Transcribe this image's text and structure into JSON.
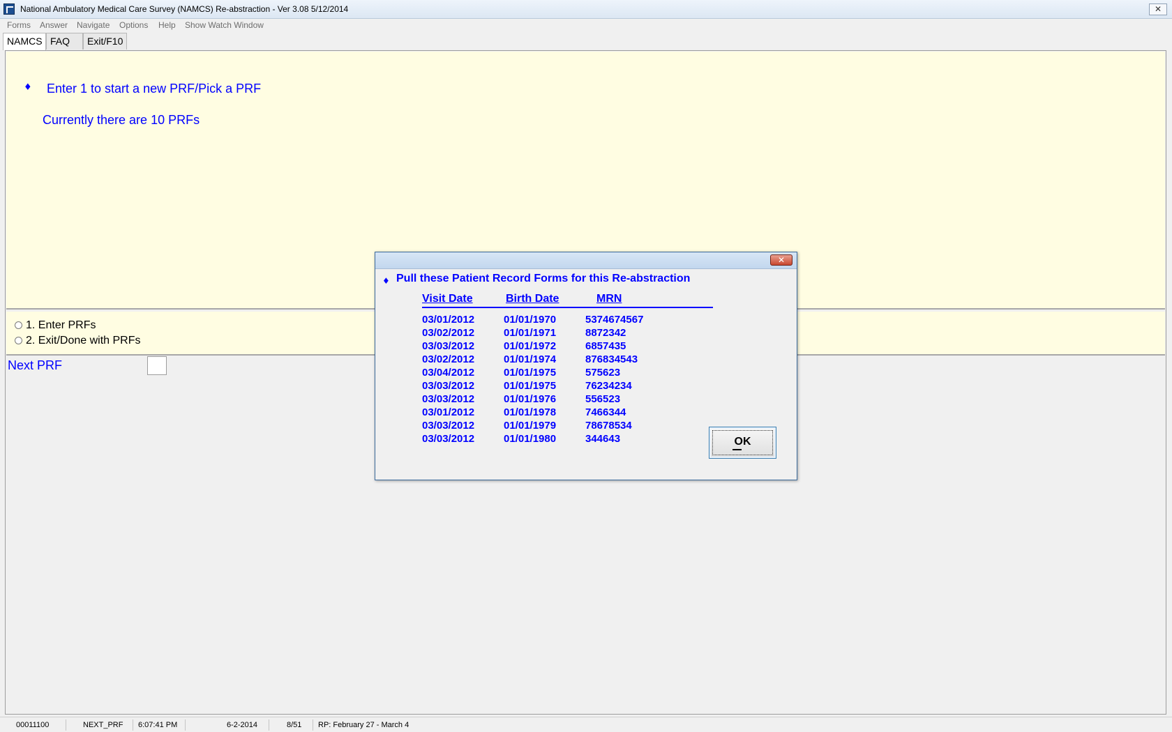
{
  "window": {
    "title": "National Ambulatory Medical Care Survey (NAMCS) Re-abstraction  - Ver 3.08 5/12/2014",
    "close_glyph": "✕"
  },
  "menu": {
    "items": [
      "Forms",
      "Answer",
      "Navigate",
      "Options",
      "Help",
      "Show Watch Window"
    ]
  },
  "tabs": [
    "NAMCS",
    "FAQ",
    "Exit/F10"
  ],
  "question": {
    "bullet": "♦",
    "prompt": "Enter 1 to start a new PRF/Pick a PRF",
    "info": "Currently there are 10 PRFs"
  },
  "answers": [
    {
      "number": "1.",
      "label": "Enter PRFs"
    },
    {
      "number": "2.",
      "label": "Exit/Done with PRFs"
    }
  ],
  "next_prf": {
    "label": "Next PRF",
    "value": ""
  },
  "dialog": {
    "bullet": "♦",
    "title": "Pull these Patient Record Forms for this Re-abstraction",
    "columns": [
      "Visit Date",
      "Birth Date",
      "MRN"
    ],
    "rows": [
      [
        "03/01/2012",
        "01/01/1970",
        "5374674567"
      ],
      [
        "03/02/2012",
        "01/01/1971",
        "8872342"
      ],
      [
        "03/03/2012",
        "01/01/1972",
        "6857435"
      ],
      [
        "03/02/2012",
        "01/01/1974",
        "876834543"
      ],
      [
        "03/04/2012",
        "01/01/1975",
        "575623"
      ],
      [
        "03/03/2012",
        "01/01/1975",
        "76234234"
      ],
      [
        "03/03/2012",
        "01/01/1976",
        "556523"
      ],
      [
        "03/01/2012",
        "01/01/1978",
        "7466344"
      ],
      [
        "03/03/2012",
        "01/01/1979",
        "78678534"
      ],
      [
        "03/03/2012",
        "01/01/1980",
        "344643"
      ]
    ],
    "ok_label": "OK",
    "close_glyph": "✕"
  },
  "status": {
    "id": "00011100",
    "field": "NEXT_PRF",
    "time": "6:07:41 PM",
    "date": "6-2-2014",
    "progress": "8/51",
    "period": "RP: February 27 - March 4"
  },
  "colors": {
    "panel_bg": "#fffde2",
    "prompt_text": "#0000ff"
  }
}
